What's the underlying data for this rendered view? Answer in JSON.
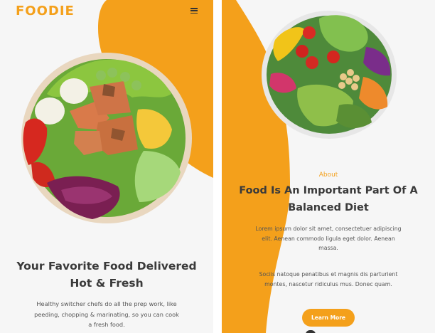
{
  "left_screen": {
    "logo": "FOODIE",
    "hero_title_line1": "Your Favorite Food Delivered",
    "hero_title_line2": "Hot & Fresh",
    "hero_text": "Healthy switcher chefs do all the prep work, like peeding, chopping & marinating, so you can cook a fresh food."
  },
  "right_screen": {
    "about_label": "About",
    "about_title_line1": "Food Is An Important Part Of A",
    "about_title_line2": "Balanced Diet",
    "paragraph1": "Lorem ipsum dolor sit amet, consectetuer adipiscing elit. Aenean commodo ligula eget dolor. Aenean massa.",
    "paragraph2": "Sociis natoque penatibus et magnis dis parturient montes, nascetur ridiculus mus. Donec quam.",
    "button_label": "Learn More"
  },
  "colors": {
    "accent": "#f4a01b",
    "background": "#f6f6f6",
    "text": "#3a3a3a"
  },
  "icons": {
    "menu": "hamburger-menu-icon"
  }
}
